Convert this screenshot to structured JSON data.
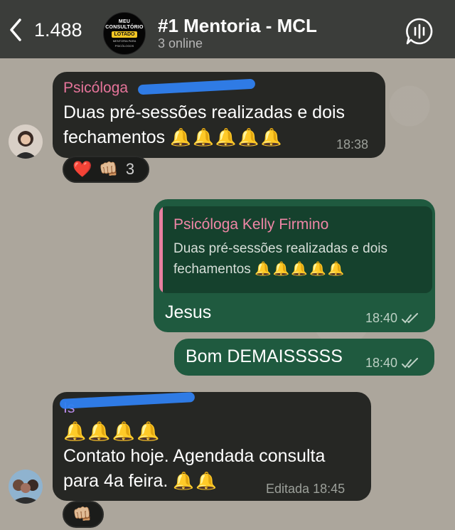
{
  "header": {
    "back_count": "1.488",
    "title": "#1 Mentoria - MCL",
    "status": "3 online",
    "logo": {
      "line1": "MEU",
      "line2": "CONSULTÓRIO",
      "badge": "LOTADO",
      "small1": "MENTORIA PARA",
      "small2": "PSICÓLOGOS"
    }
  },
  "colors": {
    "header_bg": "#3b3d3a",
    "incoming_bubble": "#262724",
    "outgoing_bubble": "#1f5a3f",
    "sender_pink": "#e6749a",
    "sender_purple": "#b98bea",
    "scribble_blue": "#2f7ff0"
  },
  "messages": [
    {
      "sender": "Psicóloga",
      "line1": "Duas pré-sessões realizadas e dois",
      "line2": "fechamentos",
      "bells": "🔔🔔🔔🔔🔔",
      "time": "18:38",
      "reactions": {
        "heart": "❤️",
        "fist": "👊🏼",
        "count": "3"
      }
    },
    {
      "quote_sender": "Psicóloga Kelly Firmino",
      "quote_line1": "Duas pré-sessões realizadas e dois",
      "quote_line2": "fechamentos",
      "quote_bells": "🔔🔔🔔🔔🔔",
      "text": "Jesus",
      "time": "18:40"
    },
    {
      "text": "Bom DEMAISSSSS",
      "time": "18:40"
    },
    {
      "sender": "Is",
      "bells": "🔔🔔🔔🔔",
      "line1": "Contato hoje. Agendada consulta",
      "line2": "para 4a feira.",
      "bells2": "🔔🔔",
      "edited": "Editada",
      "time": "18:45",
      "reactions": {
        "fist": "👊🏼"
      }
    }
  ]
}
